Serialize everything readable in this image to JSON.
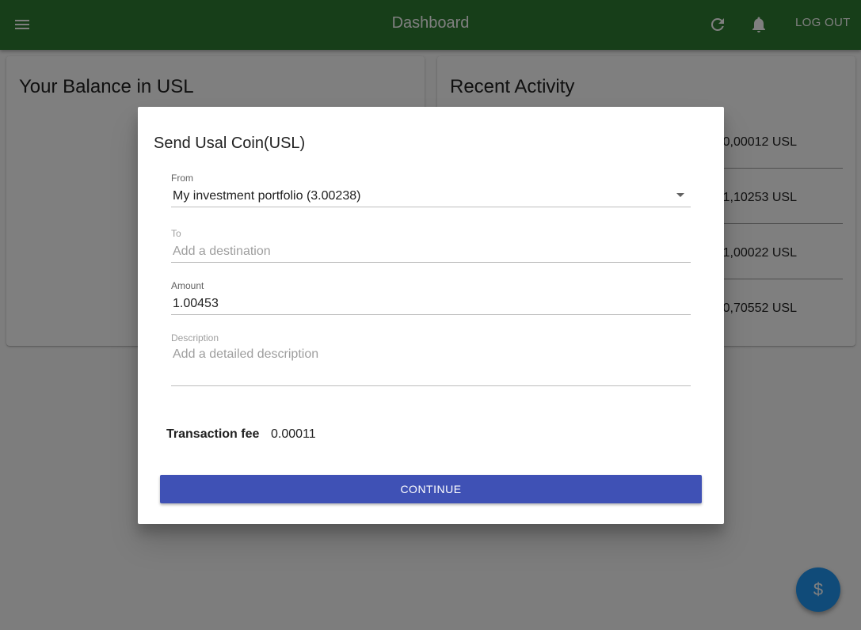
{
  "header": {
    "title": "Dashboard",
    "logout_label": "LOG OUT",
    "bg_color": "#2e7d32"
  },
  "balance_card": {
    "title": "Your Balance in USL"
  },
  "activity_card": {
    "title": "Recent Activity",
    "items": [
      {
        "amount": "0,00012 USL"
      },
      {
        "amount": "1,10253 USL"
      },
      {
        "amount": "1,00022 USL"
      },
      {
        "amount": "0,70552 USL"
      }
    ]
  },
  "dialog": {
    "title": "Send Usal Coin(USL)",
    "from": {
      "label": "From",
      "value": "My investment portfolio (3.00238)"
    },
    "to": {
      "label": "To",
      "placeholder": "Add a destination"
    },
    "amount": {
      "label": "Amount",
      "value": "1.00453"
    },
    "description": {
      "label": "Description",
      "placeholder": "Add a detailed description"
    },
    "fee": {
      "label": "Transaction fee",
      "value": "0.00011"
    },
    "continue_label": "CONTINUE",
    "accent_color": "#3f51b5"
  },
  "fab": {
    "icon": "dollar-icon",
    "glyph": "$"
  },
  "icons": {
    "menu": "menu-icon",
    "refresh": "refresh-icon",
    "notifications": "bell-icon"
  }
}
